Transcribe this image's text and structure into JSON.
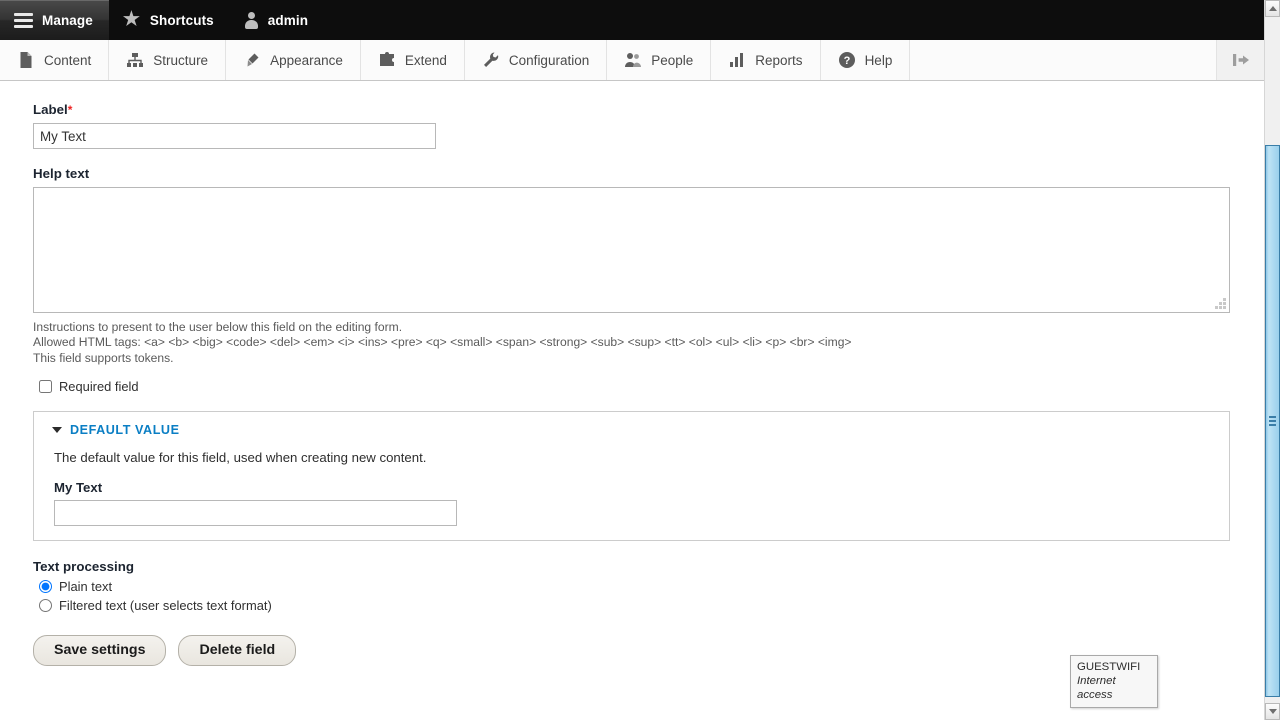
{
  "admin_bar": {
    "tabs": [
      {
        "label": "Manage",
        "icon": "hamburger-icon",
        "active": true
      },
      {
        "label": "Shortcuts",
        "icon": "star-icon",
        "active": false
      },
      {
        "label": "admin",
        "icon": "person-icon",
        "active": false
      }
    ]
  },
  "menu_bar": {
    "items": [
      {
        "label": "Content",
        "icon": "document-icon"
      },
      {
        "label": "Structure",
        "icon": "sitemap-icon"
      },
      {
        "label": "Appearance",
        "icon": "paintbrush-icon"
      },
      {
        "label": "Extend",
        "icon": "puzzle-piece-icon"
      },
      {
        "label": "Configuration",
        "icon": "wrench-icon"
      },
      {
        "label": "People",
        "icon": "people-icon"
      },
      {
        "label": "Reports",
        "icon": "bar-chart-icon"
      },
      {
        "label": "Help",
        "icon": "question-mark-icon"
      }
    ],
    "collapse_icon": "collapse-left-icon"
  },
  "form": {
    "label_field": {
      "label": "Label",
      "required_marker": "*",
      "value": "My Text",
      "placeholder": ""
    },
    "help_text_field": {
      "label": "Help text",
      "value": "",
      "placeholder": "",
      "description_line1": "Instructions to present to the user below this field on the editing form.",
      "description_line2": "Allowed HTML tags: <a> <b> <big> <code> <del> <em> <i> <ins> <pre> <q> <small> <span> <strong> <sub> <sup> <tt> <ol> <ul> <li> <p> <br> <img>",
      "description_line3": "This field supports tokens."
    },
    "required_field_checkbox": {
      "label": "Required field",
      "checked": false
    },
    "default_value": {
      "legend": "DEFAULT VALUE",
      "expanded": true,
      "description": "The default value for this field, used when creating new content.",
      "sub_label": "My Text",
      "value": "",
      "placeholder": ""
    },
    "text_processing": {
      "label": "Text processing",
      "options": [
        {
          "label": "Plain text",
          "selected": true
        },
        {
          "label": "Filtered text (user selects text format)",
          "selected": false
        }
      ]
    },
    "buttons": [
      {
        "label": "Save settings",
        "name": "save-settings-button"
      },
      {
        "label": "Delete field",
        "name": "delete-field-button"
      }
    ]
  },
  "wifi_popup": {
    "ssid": "GUESTWIFI",
    "status": "Internet access"
  },
  "colors": {
    "admin_bar_bg": "#0d0d0d",
    "link_blue": "#0a7ec4",
    "required_red": "#ee2222",
    "scrollbar_thumb": "#aedaf1"
  }
}
